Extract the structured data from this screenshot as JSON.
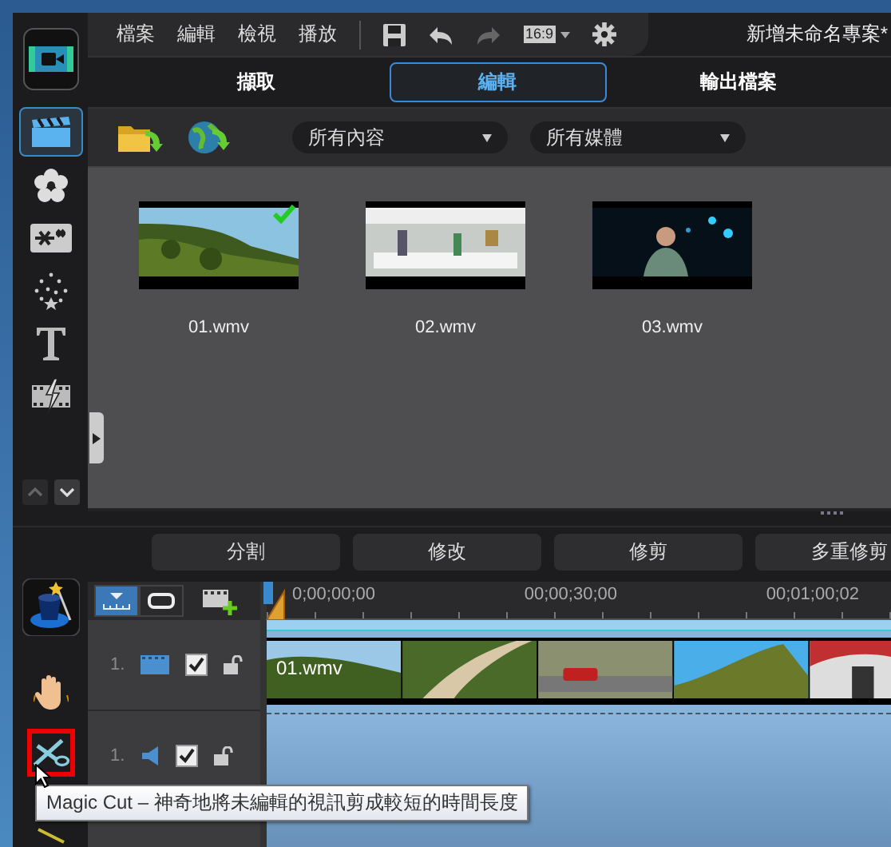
{
  "menu": [
    "檔案",
    "編輯",
    "檢視",
    "播放"
  ],
  "aspect_ratio": "16:9",
  "project_title": "新增未命名專案*",
  "tabs": [
    {
      "label": "擷取",
      "selected": false
    },
    {
      "label": "編輯",
      "selected": true
    },
    {
      "label": "輸出檔案",
      "selected": false
    }
  ],
  "rail": [
    {
      "kind": "media",
      "selected": true
    },
    {
      "kind": "fx",
      "selected": false
    },
    {
      "kind": "pip",
      "selected": false
    },
    {
      "kind": "particle",
      "selected": false
    },
    {
      "kind": "title",
      "selected": false
    },
    {
      "kind": "transition",
      "selected": false
    }
  ],
  "filters": [
    "所有內容",
    "所有媒體"
  ],
  "media": [
    {
      "name": "01.wmv",
      "kind": "forest",
      "selected": true
    },
    {
      "name": "02.wmv",
      "kind": "office",
      "selected": false
    },
    {
      "name": "03.wmv",
      "kind": "night",
      "selected": false
    }
  ],
  "edit_buttons": [
    "分割",
    "修改",
    "修剪",
    "多重修剪"
  ],
  "tools": [
    {
      "kind": "hand",
      "highlighted": false
    },
    {
      "kind": "scissors",
      "highlighted": true
    },
    {
      "kind": "wand",
      "highlighted": false
    }
  ],
  "timecodes": [
    "0;00;00;00",
    "00;00;30;00",
    "00;01;00;02"
  ],
  "tracks": [
    {
      "kind": "video",
      "number": "1.",
      "enabled": true,
      "locked": false,
      "clip": "01.wmv"
    },
    {
      "kind": "audio",
      "number": "1.",
      "enabled": true,
      "locked": false
    }
  ],
  "tooltip": "Magic Cut – 神奇地將未編輯的視訊剪成較短的時間長度"
}
